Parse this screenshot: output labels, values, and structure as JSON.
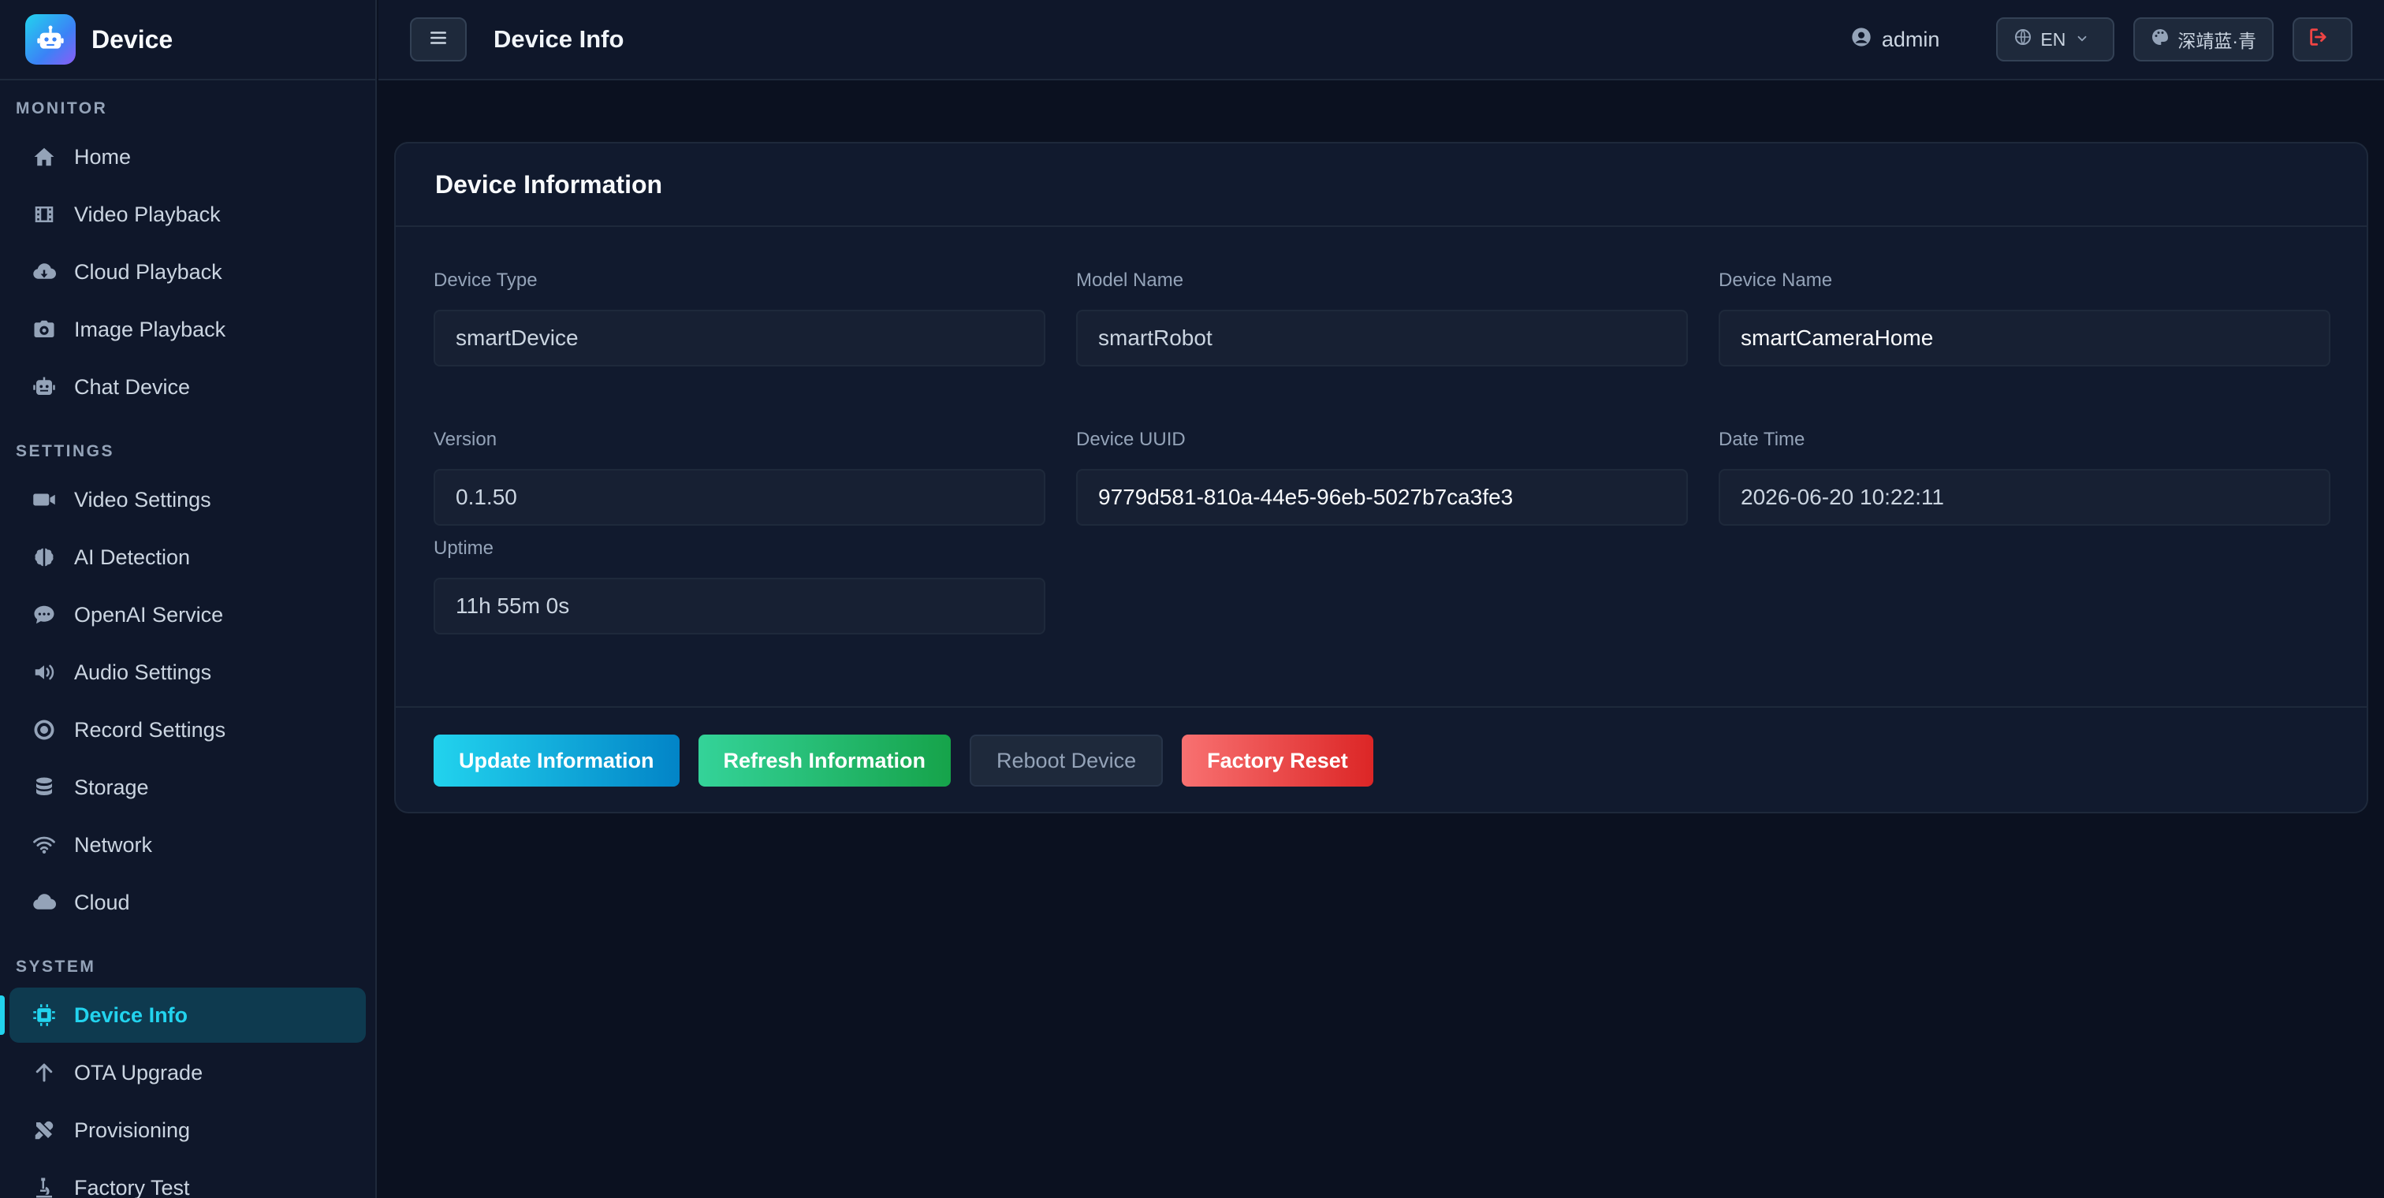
{
  "brand": {
    "title": "Device"
  },
  "sidebar": {
    "sections": [
      {
        "title": "MONITOR",
        "items": [
          {
            "label": "Home",
            "icon": "home-icon"
          },
          {
            "label": "Video Playback",
            "icon": "film-icon"
          },
          {
            "label": "Cloud Playback",
            "icon": "cloud-download-icon"
          },
          {
            "label": "Image Playback",
            "icon": "camera-icon"
          },
          {
            "label": "Chat Device",
            "icon": "robot-icon"
          }
        ]
      },
      {
        "title": "SETTINGS",
        "items": [
          {
            "label": "Video Settings",
            "icon": "video-camera-icon"
          },
          {
            "label": "AI Detection",
            "icon": "brain-icon"
          },
          {
            "label": "OpenAI Service",
            "icon": "chat-bubble-icon"
          },
          {
            "label": "Audio Settings",
            "icon": "speaker-icon"
          },
          {
            "label": "Record Settings",
            "icon": "record-icon"
          },
          {
            "label": "Storage",
            "icon": "database-icon"
          },
          {
            "label": "Network",
            "icon": "wifi-icon"
          },
          {
            "label": "Cloud",
            "icon": "cloud-icon"
          }
        ]
      },
      {
        "title": "SYSTEM",
        "items": [
          {
            "label": "Device Info",
            "icon": "chip-icon",
            "active": true
          },
          {
            "label": "OTA Upgrade",
            "icon": "arrow-up-icon"
          },
          {
            "label": "Provisioning",
            "icon": "tools-icon"
          },
          {
            "label": "Factory Test",
            "icon": "microscope-icon"
          }
        ]
      }
    ]
  },
  "header": {
    "title": "Device Info",
    "user": "admin",
    "language": "EN",
    "theme": "深靖蓝·青"
  },
  "card": {
    "title": "Device Information",
    "fields": {
      "device_type": {
        "label": "Device Type",
        "value": "smartDevice"
      },
      "model_name": {
        "label": "Model Name",
        "value": "smartRobot"
      },
      "device_name": {
        "label": "Device Name",
        "value": "smartCameraHome"
      },
      "version": {
        "label": "Version",
        "value": "0.1.50"
      },
      "device_uuid": {
        "label": "Device UUID",
        "value": "9779d581-810a-44e5-96eb-5027b7ca3fe3"
      },
      "date_time": {
        "label": "Date Time",
        "value": "2026-06-20 10:22:11"
      },
      "uptime": {
        "label": "Uptime",
        "value": "11h 55m 0s"
      }
    },
    "buttons": {
      "update": "Update Information",
      "refresh": "Refresh Information",
      "reboot": "Reboot Device",
      "reset": "Factory Reset"
    }
  },
  "colors": {
    "accent": "#22d3ee",
    "background": "#0b1120",
    "sidebar": "#0f172a",
    "danger": "#ef4444",
    "success": "#22c55e"
  }
}
